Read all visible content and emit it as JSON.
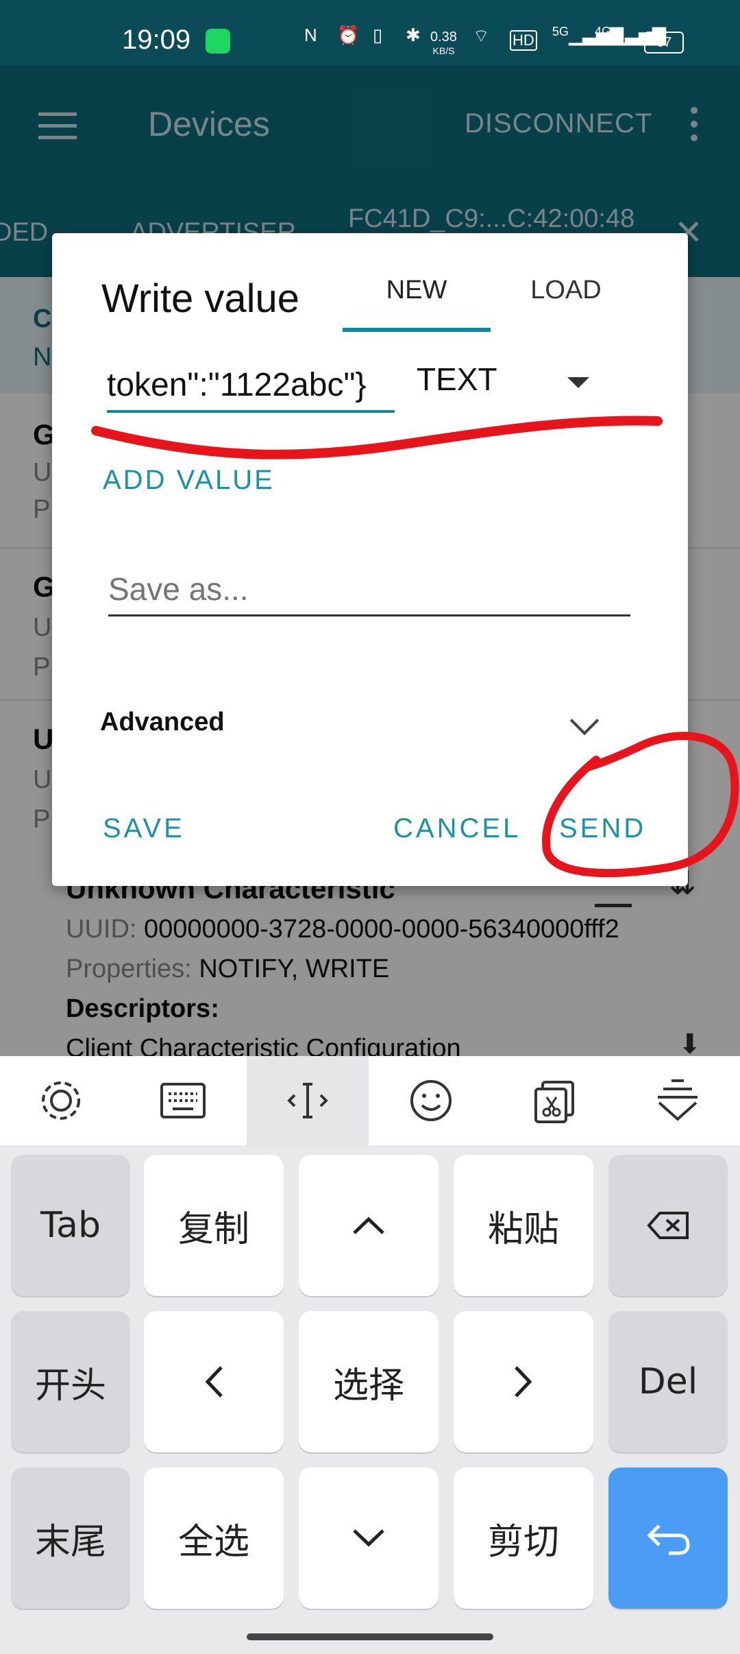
{
  "status_bar": {
    "time": "19:09",
    "speed": "0.38",
    "speed_unit": "KB/S",
    "network_1": "5G",
    "network_2": "4G",
    "hd_label": "HD",
    "battery": "67"
  },
  "app_bar": {
    "title": "Devices",
    "disconnect_label": "DISCONNECT",
    "tabs": [
      "DED",
      "ADVERTISER",
      "FC41D_C9:...C:42:00:48"
    ]
  },
  "background_list": {
    "first_letters": [
      "C",
      "N",
      "G",
      "U",
      "P",
      "G",
      "U",
      "P",
      "U",
      "U",
      "P"
    ],
    "characteristic": {
      "title": "Unknown Characteristic",
      "uuid_label": "UUID:",
      "uuid_value": "00000000-3728-0000-0000-56340000fff2",
      "properties_label": "Properties:",
      "properties_value": "NOTIFY, WRITE",
      "descriptors_label": "Descriptors:",
      "descriptor_item": "Client Characteristic Configuration"
    }
  },
  "dialog": {
    "title": "Write value",
    "tabs": {
      "new": "NEW",
      "load": "LOAD"
    },
    "value_input": "token\":\"1122abc\"}",
    "format": "TEXT",
    "add_value": "ADD VALUE",
    "save_as_placeholder": "Save as...",
    "advanced": "Advanced",
    "save": "SAVE",
    "cancel": "CANCEL",
    "send": "SEND"
  },
  "keyboard": {
    "toolbar": [
      "settings-icon",
      "keyboard-icon",
      "cursor-icon",
      "emoji-icon",
      "clipboard-icon",
      "collapse-icon"
    ],
    "rows": [
      [
        "Tab",
        "复制",
        "^",
        "粘贴",
        "⌫"
      ],
      [
        "开头",
        "<",
        "选择",
        ">",
        "Del"
      ],
      [
        "末尾",
        "全选",
        "∨",
        "剪切",
        "↩"
      ]
    ]
  },
  "colors": {
    "app_bar": "#0f6f80",
    "accent": "#1a93a8",
    "annotation": "#e8141c",
    "enter_key": "#4a9cf5"
  }
}
